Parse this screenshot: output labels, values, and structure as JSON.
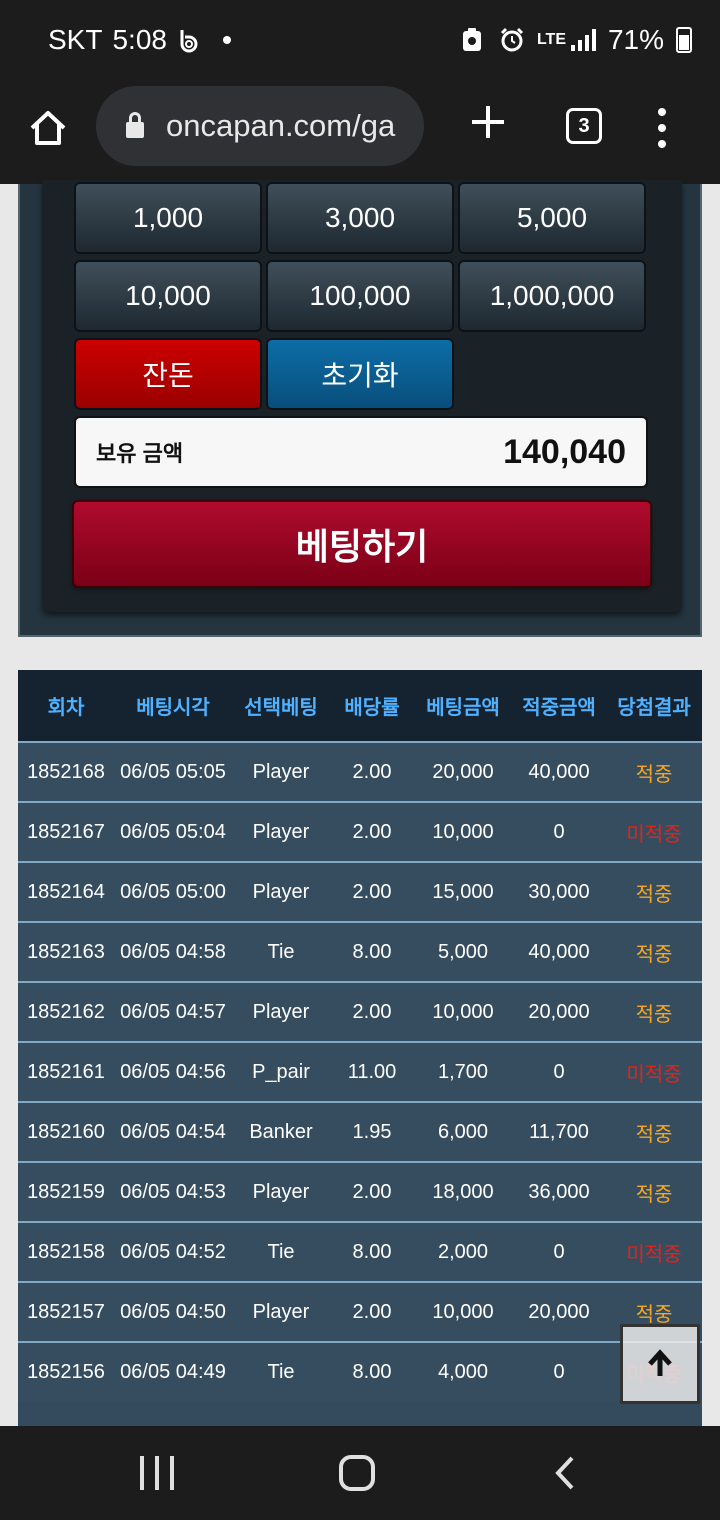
{
  "status_bar": {
    "carrier": "SKT",
    "time": "5:08",
    "network": "LTE",
    "battery": "71%"
  },
  "browser": {
    "url": "oncapan.com/ga",
    "tab_count": "3"
  },
  "chips": {
    "c1000": "1,000",
    "c3000": "3,000",
    "c5000": "5,000",
    "c10000": "10,000",
    "c100000": "100,000",
    "c1000000": "1,000,000",
    "change": "잔돈",
    "reset": "초기화"
  },
  "balance": {
    "label": "보유 금액",
    "value": "140,040"
  },
  "bet_button": "베팅하기",
  "table": {
    "headers": [
      "회차",
      "베팅시각",
      "선택베팅",
      "배당률",
      "베팅금액",
      "적중금액",
      "당첨결과"
    ],
    "rows": [
      [
        "1852168",
        "06/05 05:05",
        "Player",
        "2.00",
        "20,000",
        "40,000",
        "적중"
      ],
      [
        "1852167",
        "06/05 05:04",
        "Player",
        "2.00",
        "10,000",
        "0",
        "미적중"
      ],
      [
        "1852164",
        "06/05 05:00",
        "Player",
        "2.00",
        "15,000",
        "30,000",
        "적중"
      ],
      [
        "1852163",
        "06/05 04:58",
        "Tie",
        "8.00",
        "5,000",
        "40,000",
        "적중"
      ],
      [
        "1852162",
        "06/05 04:57",
        "Player",
        "2.00",
        "10,000",
        "20,000",
        "적중"
      ],
      [
        "1852161",
        "06/05 04:56",
        "P_pair",
        "11.00",
        "1,700",
        "0",
        "미적중"
      ],
      [
        "1852160",
        "06/05 04:54",
        "Banker",
        "1.95",
        "6,000",
        "11,700",
        "적중"
      ],
      [
        "1852159",
        "06/05 04:53",
        "Player",
        "2.00",
        "18,000",
        "36,000",
        "적중"
      ],
      [
        "1852158",
        "06/05 04:52",
        "Tie",
        "8.00",
        "2,000",
        "0",
        "미적중"
      ],
      [
        "1852157",
        "06/05 04:50",
        "Player",
        "2.00",
        "10,000",
        "20,000",
        "적중"
      ],
      [
        "1852156",
        "06/05 04:49",
        "Tie",
        "8.00",
        "4,000",
        "0",
        "미적중"
      ]
    ]
  },
  "colors": {
    "win": "#f6a623",
    "lose": "#e2231a",
    "header_text": "#4fb1ff"
  }
}
